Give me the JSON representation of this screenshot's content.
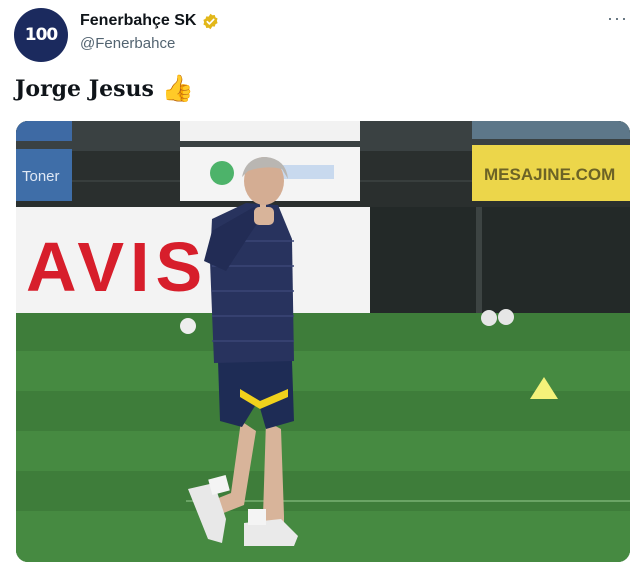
{
  "account": {
    "avatar_text": "100",
    "display_name": "Fenerbahçe SK",
    "handle": "@Fenerbahce",
    "verified_icon": "verified-badge-gold"
  },
  "tweet": {
    "text": "Jorge Jesus",
    "emoji": "👍"
  },
  "menu": {
    "more_label": "···"
  },
  "media": {
    "board_text_left": "AVIS",
    "board_text_right": "MESAJINE.COM",
    "board_text_small": "Toner"
  },
  "colors": {
    "verified": "#e2b719",
    "brand_navy": "#1b2a5e",
    "avis_red": "#d71e2b"
  }
}
